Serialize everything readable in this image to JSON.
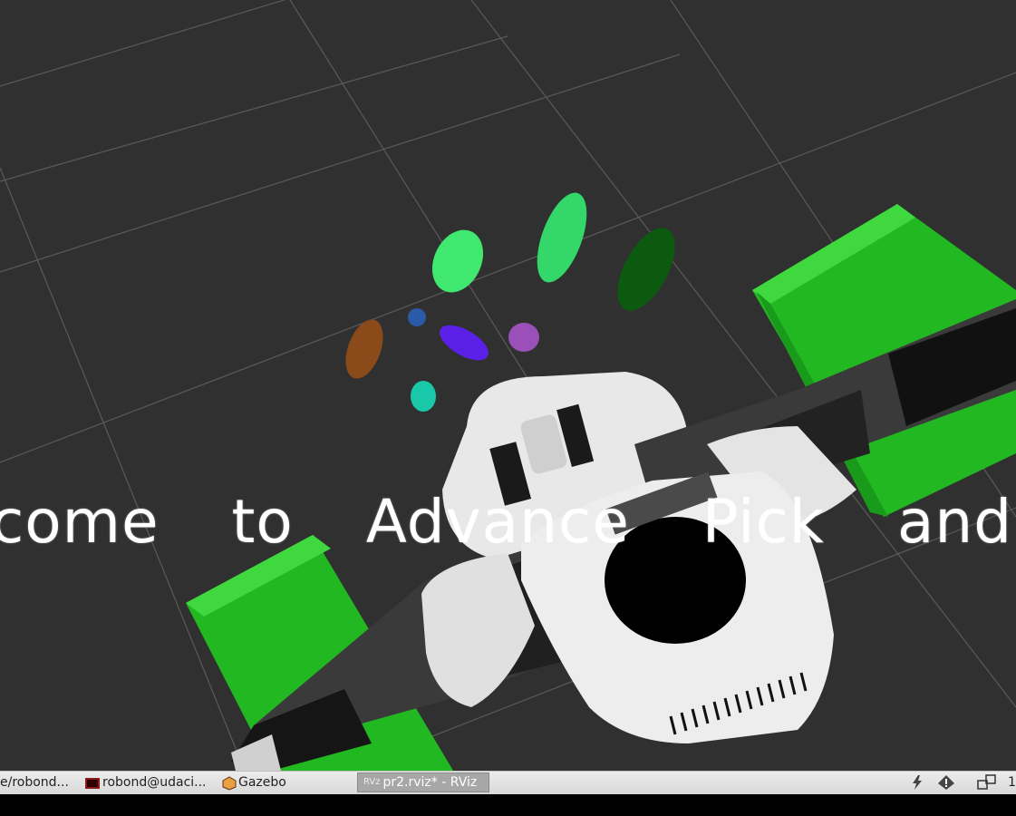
{
  "viewport": {
    "banner_text": "come  to  Advance  Pick  and  Place"
  },
  "taskbar": {
    "tasks": [
      {
        "label": "e/robond...",
        "icon": "terminal-icon"
      },
      {
        "label": "robond@udaci...",
        "icon": "terminal-icon"
      },
      {
        "label": "Gazebo",
        "icon": "gazebo-icon"
      },
      {
        "label": "pr2.rviz* - RViz",
        "icon": "rviz-icon",
        "active": true
      }
    ],
    "tray": {
      "power_icon": "lightning-icon",
      "alert_icon": "warning-icon",
      "workspace_icon": "workspace-icon",
      "clock_fragment": "1"
    }
  },
  "colors": {
    "background": "#303030",
    "table_green": "#2ec82e",
    "cluster_colors": [
      "#8a4a1a",
      "#2a5aa8",
      "#5a20e8",
      "#9a50b8",
      "#40e870",
      "#34d86a",
      "#0c5a10",
      "#18c8a8"
    ]
  }
}
